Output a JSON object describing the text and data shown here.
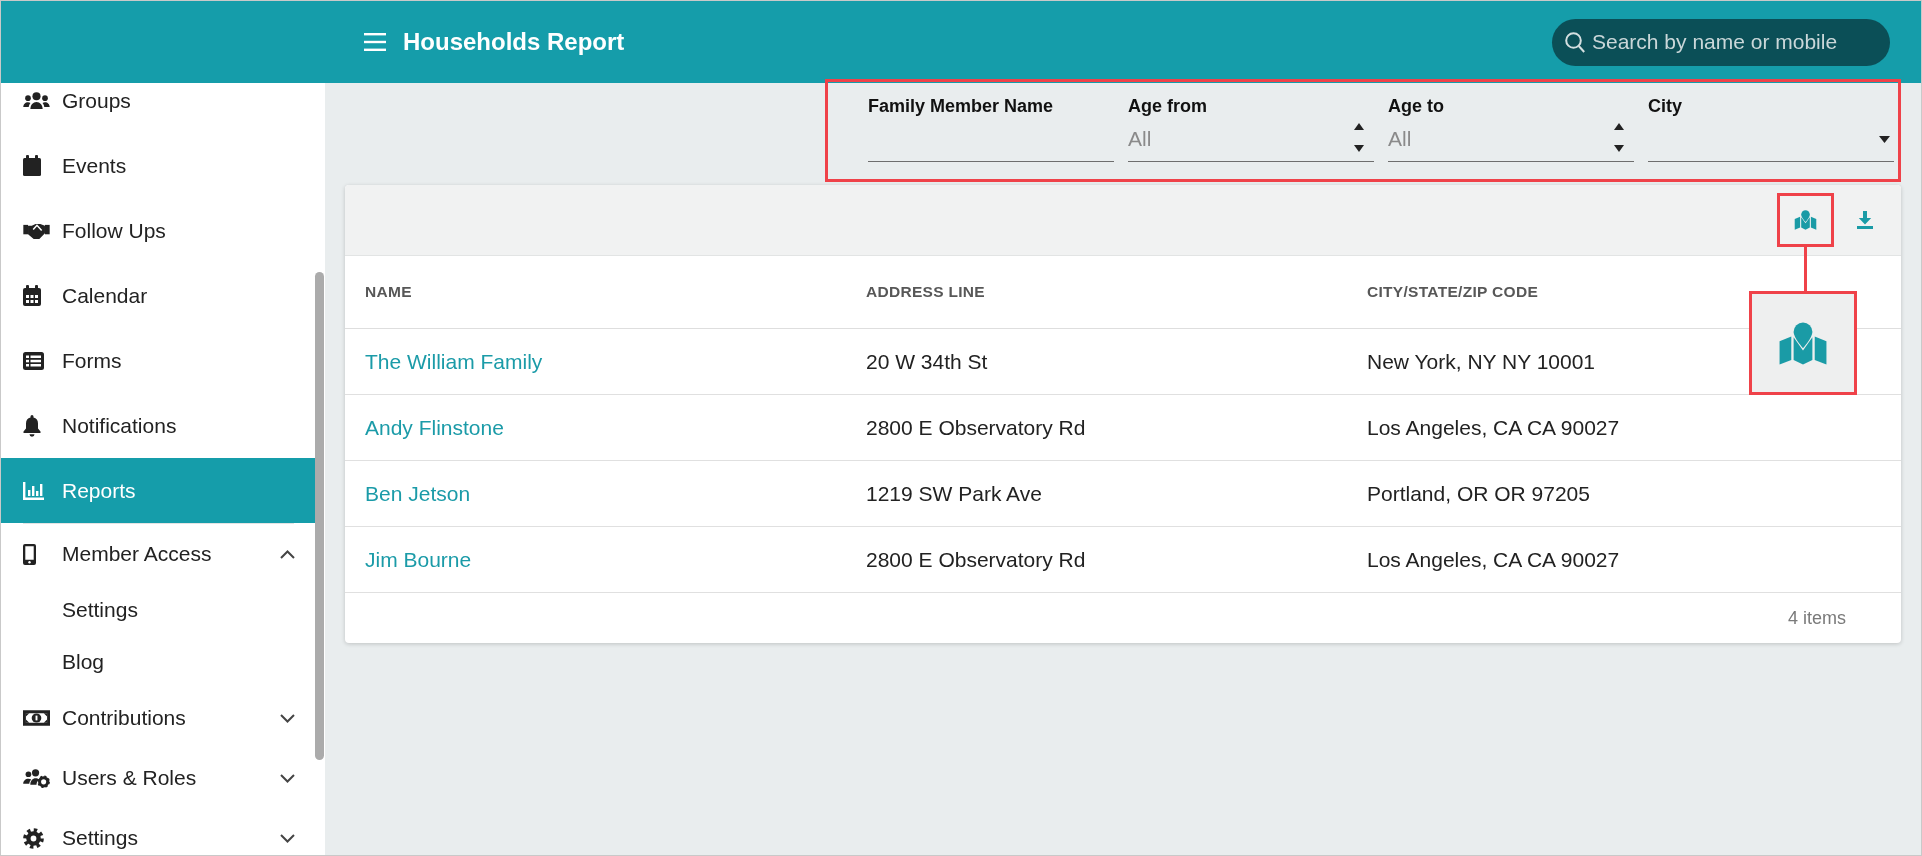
{
  "header": {
    "title": "Households Report",
    "search": {
      "placeholder": "Search by name or mobile"
    }
  },
  "sidebar": {
    "items": [
      {
        "kind": "link",
        "label": "Groups",
        "selected": false
      },
      {
        "kind": "link",
        "label": "Events",
        "selected": false
      },
      {
        "kind": "link",
        "label": "Follow Ups",
        "selected": false
      },
      {
        "kind": "link",
        "label": "Calendar",
        "selected": false
      },
      {
        "kind": "link",
        "label": "Forms",
        "selected": false
      },
      {
        "kind": "link",
        "label": "Notifications",
        "selected": false
      },
      {
        "kind": "link",
        "label": "Reports",
        "selected": true
      },
      {
        "kind": "group",
        "label": "Member Access",
        "selected": false,
        "expanded": true,
        "children": [
          {
            "label": "Settings",
            "selected": false
          },
          {
            "label": "Blog",
            "selected": false
          }
        ]
      },
      {
        "kind": "group",
        "label": "Contributions",
        "selected": false,
        "expanded": false
      },
      {
        "kind": "group",
        "label": "Users & Roles",
        "selected": false,
        "expanded": false
      },
      {
        "kind": "group",
        "label": "Settings",
        "selected": false,
        "expanded": false
      }
    ]
  },
  "filters": {
    "highlighted": true,
    "fields": [
      {
        "kind": "text",
        "label": "Family Member Name"
      },
      {
        "kind": "number",
        "label": "Age from",
        "placeholder": "All"
      },
      {
        "kind": "number",
        "label": "Age to",
        "placeholder": "All"
      },
      {
        "kind": "select",
        "label": "City"
      }
    ]
  },
  "toolbar": {
    "buttons": [
      {
        "highlighted": true,
        "magnified": true
      },
      {
        "highlighted": false,
        "magnified": false
      }
    ]
  },
  "table": {
    "columns": [
      "NAME",
      "ADDRESS LINE",
      "CITY/STATE/ZIP CODE"
    ],
    "rows": [
      {
        "name": "The William Family",
        "address": "20 W 34th St",
        "city": "New York, NY NY 10001"
      },
      {
        "name": "Andy Flinstone",
        "address": "2800 E Observatory Rd",
        "city": "Los Angeles, CA CA 90027"
      },
      {
        "name": "Ben Jetson",
        "address": "1219 SW Park Ave",
        "city": "Portland, OR OR 97205"
      },
      {
        "name": "Jim Bourne",
        "address": "2800 E Observatory Rd",
        "city": "Los Angeles, CA CA 90027"
      }
    ],
    "footer": "4 items"
  }
}
